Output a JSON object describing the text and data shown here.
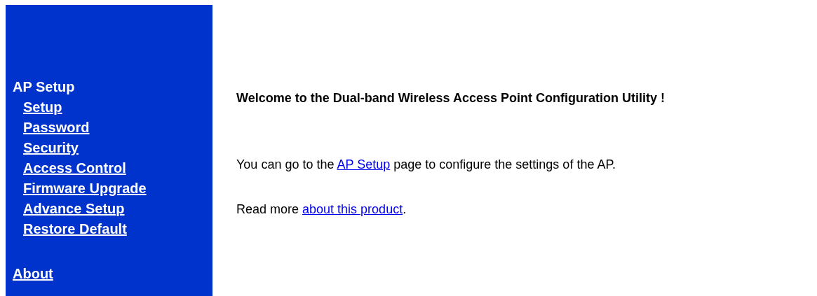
{
  "sidebar": {
    "section_title": "AP Setup",
    "items": [
      {
        "label": "Setup"
      },
      {
        "label": "Password"
      },
      {
        "label": "Security"
      },
      {
        "label": "Access Control"
      },
      {
        "label": "Firmware Upgrade"
      },
      {
        "label": "Advance Setup"
      },
      {
        "label": "Restore Default"
      }
    ],
    "about": "About"
  },
  "main": {
    "heading": "Welcome to the Dual-band Wireless Access Point Configuration Utility !",
    "paragraphs": [
      {
        "before": "You can go to the ",
        "link": "AP Setup",
        "after": " page to configure the settings of the AP."
      },
      {
        "before": "Read more ",
        "link": "about this product",
        "after": "."
      }
    ]
  }
}
